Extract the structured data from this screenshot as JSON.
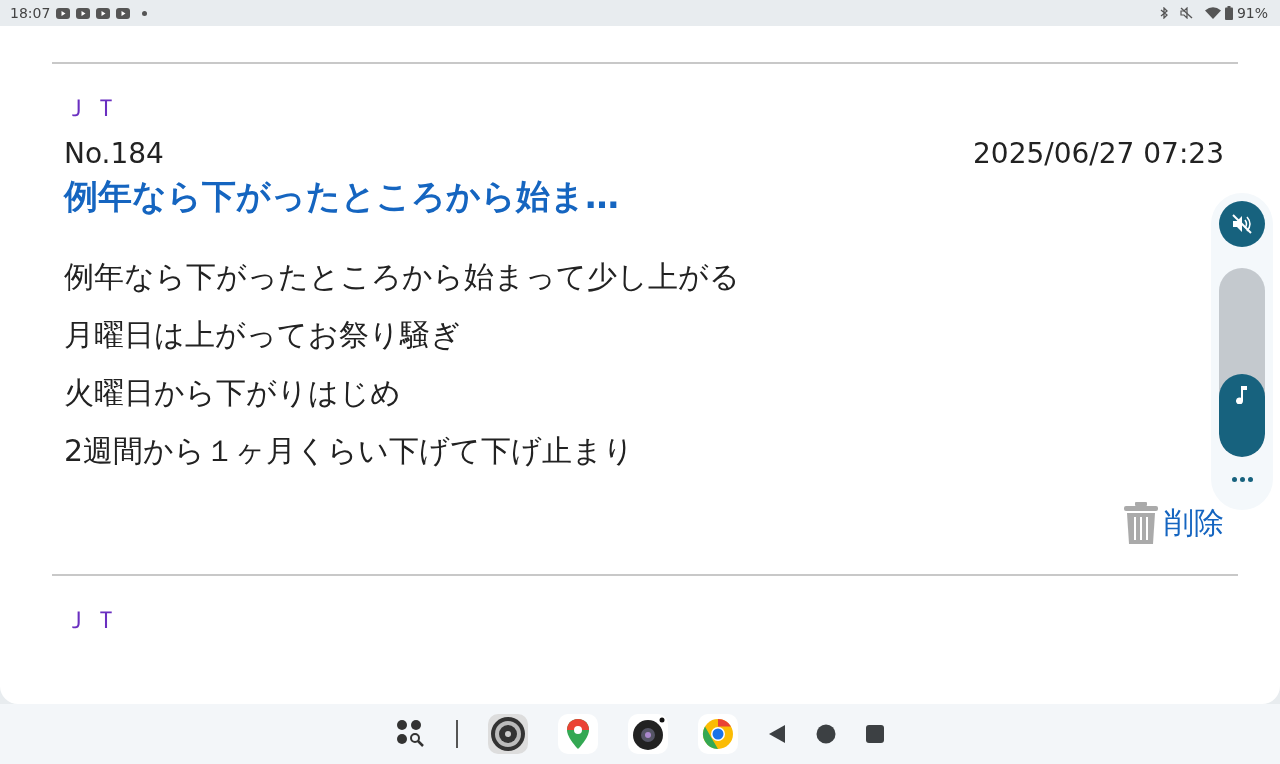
{
  "status_bar": {
    "time": "18:07",
    "battery": "91%"
  },
  "posts": [
    {
      "author": "ＪＴ",
      "number": "No.184",
      "date": "2025/06/27 07:23",
      "title": "例年なら下がったところから始ま…",
      "body": [
        "例年なら下がったところから始まって少し上がる",
        "月曜日は上がってお祭り騒ぎ",
        "火曜日から下がりはじめ",
        "2週間から１ヶ月くらい下げて下げ止まり"
      ],
      "delete_label": "削除"
    },
    {
      "author": "ＪＴ"
    }
  ],
  "volume_panel": {
    "level": 0.44
  }
}
